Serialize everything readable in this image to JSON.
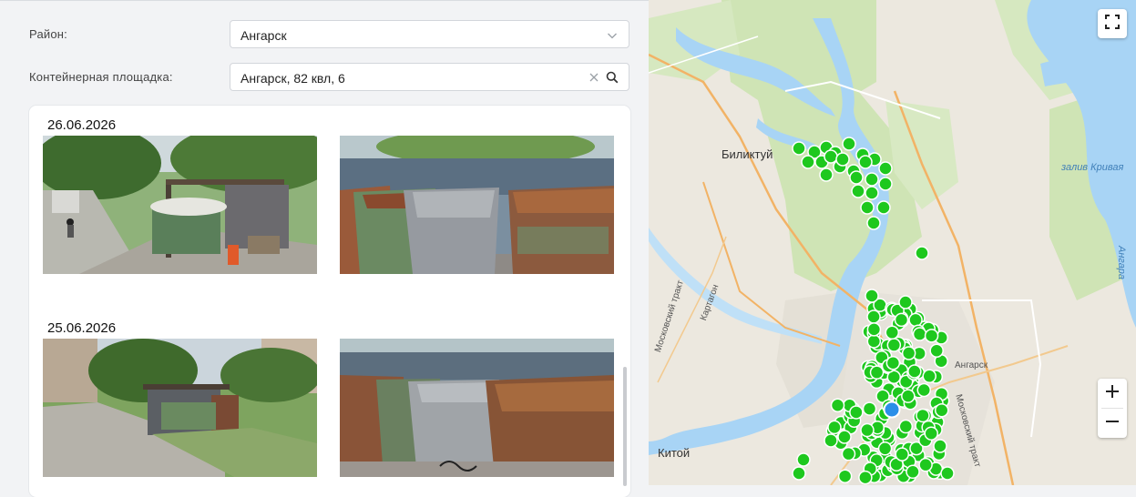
{
  "filters": {
    "district_label": "Район:",
    "district_value": "Ангарск",
    "site_label": "Контейнерная площадка:",
    "site_value": "Ангарск, 82 квл, 6"
  },
  "photos": {
    "groups": [
      {
        "date": "26.06.2026"
      },
      {
        "date": "25.06.2026"
      }
    ]
  },
  "map": {
    "labels": {
      "biliktuy": "Биликтуй",
      "angarsk": "Ангарск",
      "kitoy": "Китой",
      "zaliv": "залив Кривая",
      "moskovsky_trakt_left": "Московский тракт",
      "moskovsky_trakt_right": "Московский тракт",
      "kartagon": "Картагон",
      "angara": "Ангара"
    },
    "colors": {
      "marker": "#1ec81e",
      "marker_stroke": "#ffffff",
      "selected_marker": "#2b8fe8",
      "water": "#a8d4f5",
      "green": "#cfe4b5",
      "road": "#f2b366"
    },
    "icons": {
      "fullscreen": "fullscreen-icon",
      "zoom_in": "plus-icon",
      "zoom_out": "minus-icon"
    }
  }
}
